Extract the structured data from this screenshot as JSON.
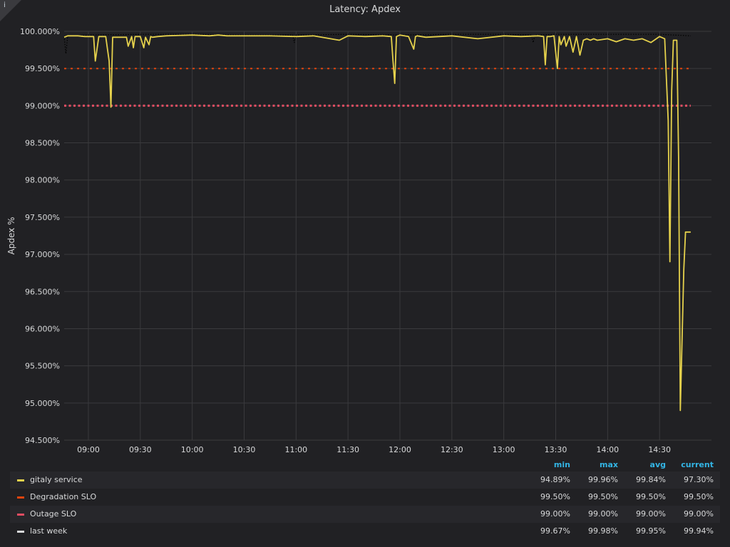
{
  "chart_data": {
    "type": "line",
    "title": "Latency: Apdex",
    "ylabel": "Apdex %",
    "xlabel": "",
    "ylim": [
      94.5,
      100.0
    ],
    "xlim": [
      "08:46",
      "15:00"
    ],
    "y_ticks": [
      "94.500%",
      "95.000%",
      "95.500%",
      "96.000%",
      "96.500%",
      "97.000%",
      "97.500%",
      "98.000%",
      "98.500%",
      "99.000%",
      "99.500%",
      "100.000%"
    ],
    "x_ticks": [
      "09:00",
      "09:30",
      "10:00",
      "10:30",
      "11:00",
      "11:30",
      "12:00",
      "12:30",
      "13:00",
      "13:30",
      "14:00",
      "14:30"
    ],
    "grid": true,
    "legend_position": "bottom",
    "series": [
      {
        "name": "gitaly service",
        "color": "#e5d14c",
        "style": "solid",
        "x": [
          "08:46",
          "08:48",
          "08:54",
          "08:58",
          "09:03",
          "09:04",
          "09:06",
          "09:10",
          "09:12",
          "09:13",
          "09:14",
          "09:17",
          "09:22",
          "09:23",
          "09:25",
          "09:26",
          "09:27",
          "09:30",
          "09:32",
          "09:33",
          "09:35",
          "09:36",
          "09:37",
          "09:40",
          "09:45",
          "10:00",
          "10:10",
          "10:15",
          "10:20",
          "10:30",
          "10:45",
          "11:00",
          "11:10",
          "11:25",
          "11:30",
          "11:40",
          "11:50",
          "11:55",
          "11:56",
          "11:57",
          "11:58",
          "12:00",
          "12:05",
          "12:08",
          "12:09",
          "12:10",
          "12:15",
          "12:30",
          "12:45",
          "13:00",
          "13:10",
          "13:20",
          "13:23",
          "13:24",
          "13:25",
          "13:27",
          "13:29",
          "13:31",
          "13:32",
          "13:33",
          "13:35",
          "13:36",
          "13:38",
          "13:40",
          "13:42",
          "13:44",
          "13:46",
          "13:48",
          "13:50",
          "13:52",
          "13:54",
          "14:00",
          "14:05",
          "14:10",
          "14:15",
          "14:20",
          "14:25",
          "14:30",
          "14:33",
          "14:35",
          "14:36",
          "14:37",
          "14:38",
          "14:40",
          "14:41",
          "14:42",
          "14:44",
          "14:45",
          "14:46",
          "14:47",
          "14:48"
        ],
        "y": [
          99.92,
          99.94,
          99.94,
          99.93,
          99.93,
          99.6,
          99.93,
          99.93,
          99.6,
          98.98,
          99.92,
          99.92,
          99.92,
          99.8,
          99.93,
          99.78,
          99.93,
          99.93,
          99.78,
          99.92,
          99.82,
          99.93,
          99.92,
          99.93,
          99.94,
          99.95,
          99.94,
          99.95,
          99.94,
          99.94,
          99.94,
          99.93,
          99.94,
          99.88,
          99.94,
          99.93,
          99.94,
          99.93,
          99.6,
          99.3,
          99.93,
          99.95,
          99.93,
          99.76,
          99.93,
          99.94,
          99.92,
          99.94,
          99.9,
          99.94,
          99.93,
          99.94,
          99.93,
          99.55,
          99.93,
          99.93,
          99.94,
          99.5,
          99.93,
          99.82,
          99.93,
          99.8,
          99.93,
          99.72,
          99.93,
          99.68,
          99.88,
          99.9,
          99.88,
          99.9,
          99.88,
          99.9,
          99.86,
          99.9,
          99.88,
          99.9,
          99.85,
          99.93,
          99.9,
          98.8,
          96.9,
          99.2,
          99.88,
          99.88,
          98.3,
          94.9,
          96.8,
          97.3,
          97.3,
          97.3,
          97.3
        ]
      },
      {
        "name": "Degradation SLO",
        "color": "#e0440e",
        "style": "dashed",
        "x": [
          "08:46",
          "14:48"
        ],
        "y": [
          99.5,
          99.5
        ]
      },
      {
        "name": "Outage SLO",
        "color": "#e24d62",
        "style": "dotted",
        "x": [
          "08:46",
          "14:48"
        ],
        "y": [
          99.0,
          99.0
        ]
      },
      {
        "name": "last week",
        "color": "#d8d9da",
        "style": "dotted-black",
        "x": [
          "08:46",
          "08:47",
          "08:48",
          "08:49",
          "08:52",
          "09:00",
          "09:30",
          "10:00",
          "10:30",
          "10:58",
          "10:59",
          "11:00",
          "11:30",
          "12:00",
          "12:30",
          "13:00",
          "13:16",
          "13:17",
          "13:18",
          "13:30",
          "14:00",
          "14:30",
          "14:48"
        ],
        "y": [
          99.93,
          99.7,
          99.93,
          99.94,
          99.94,
          99.95,
          99.96,
          99.96,
          99.95,
          99.95,
          99.85,
          99.95,
          99.96,
          99.95,
          99.96,
          99.96,
          99.95,
          99.85,
          99.95,
          99.96,
          99.96,
          99.96,
          99.94
        ]
      }
    ]
  },
  "legend": {
    "headers": {
      "min": "min",
      "max": "max",
      "avg": "avg",
      "current": "current"
    },
    "rows": [
      {
        "name": "gitaly service",
        "color": "#e5d14c",
        "min": "94.89%",
        "max": "99.96%",
        "avg": "99.84%",
        "current": "97.30%"
      },
      {
        "name": "Degradation SLO",
        "color": "#e0440e",
        "min": "99.50%",
        "max": "99.50%",
        "avg": "99.50%",
        "current": "99.50%"
      },
      {
        "name": "Outage SLO",
        "color": "#e24d62",
        "min": "99.00%",
        "max": "99.00%",
        "avg": "99.00%",
        "current": "99.00%"
      },
      {
        "name": "last week",
        "color": "#d8d9da",
        "min": "99.67%",
        "max": "99.98%",
        "avg": "99.95%",
        "current": "99.94%"
      }
    ]
  },
  "panel": {
    "info_icon": "info-icon",
    "info_glyph": "i"
  }
}
